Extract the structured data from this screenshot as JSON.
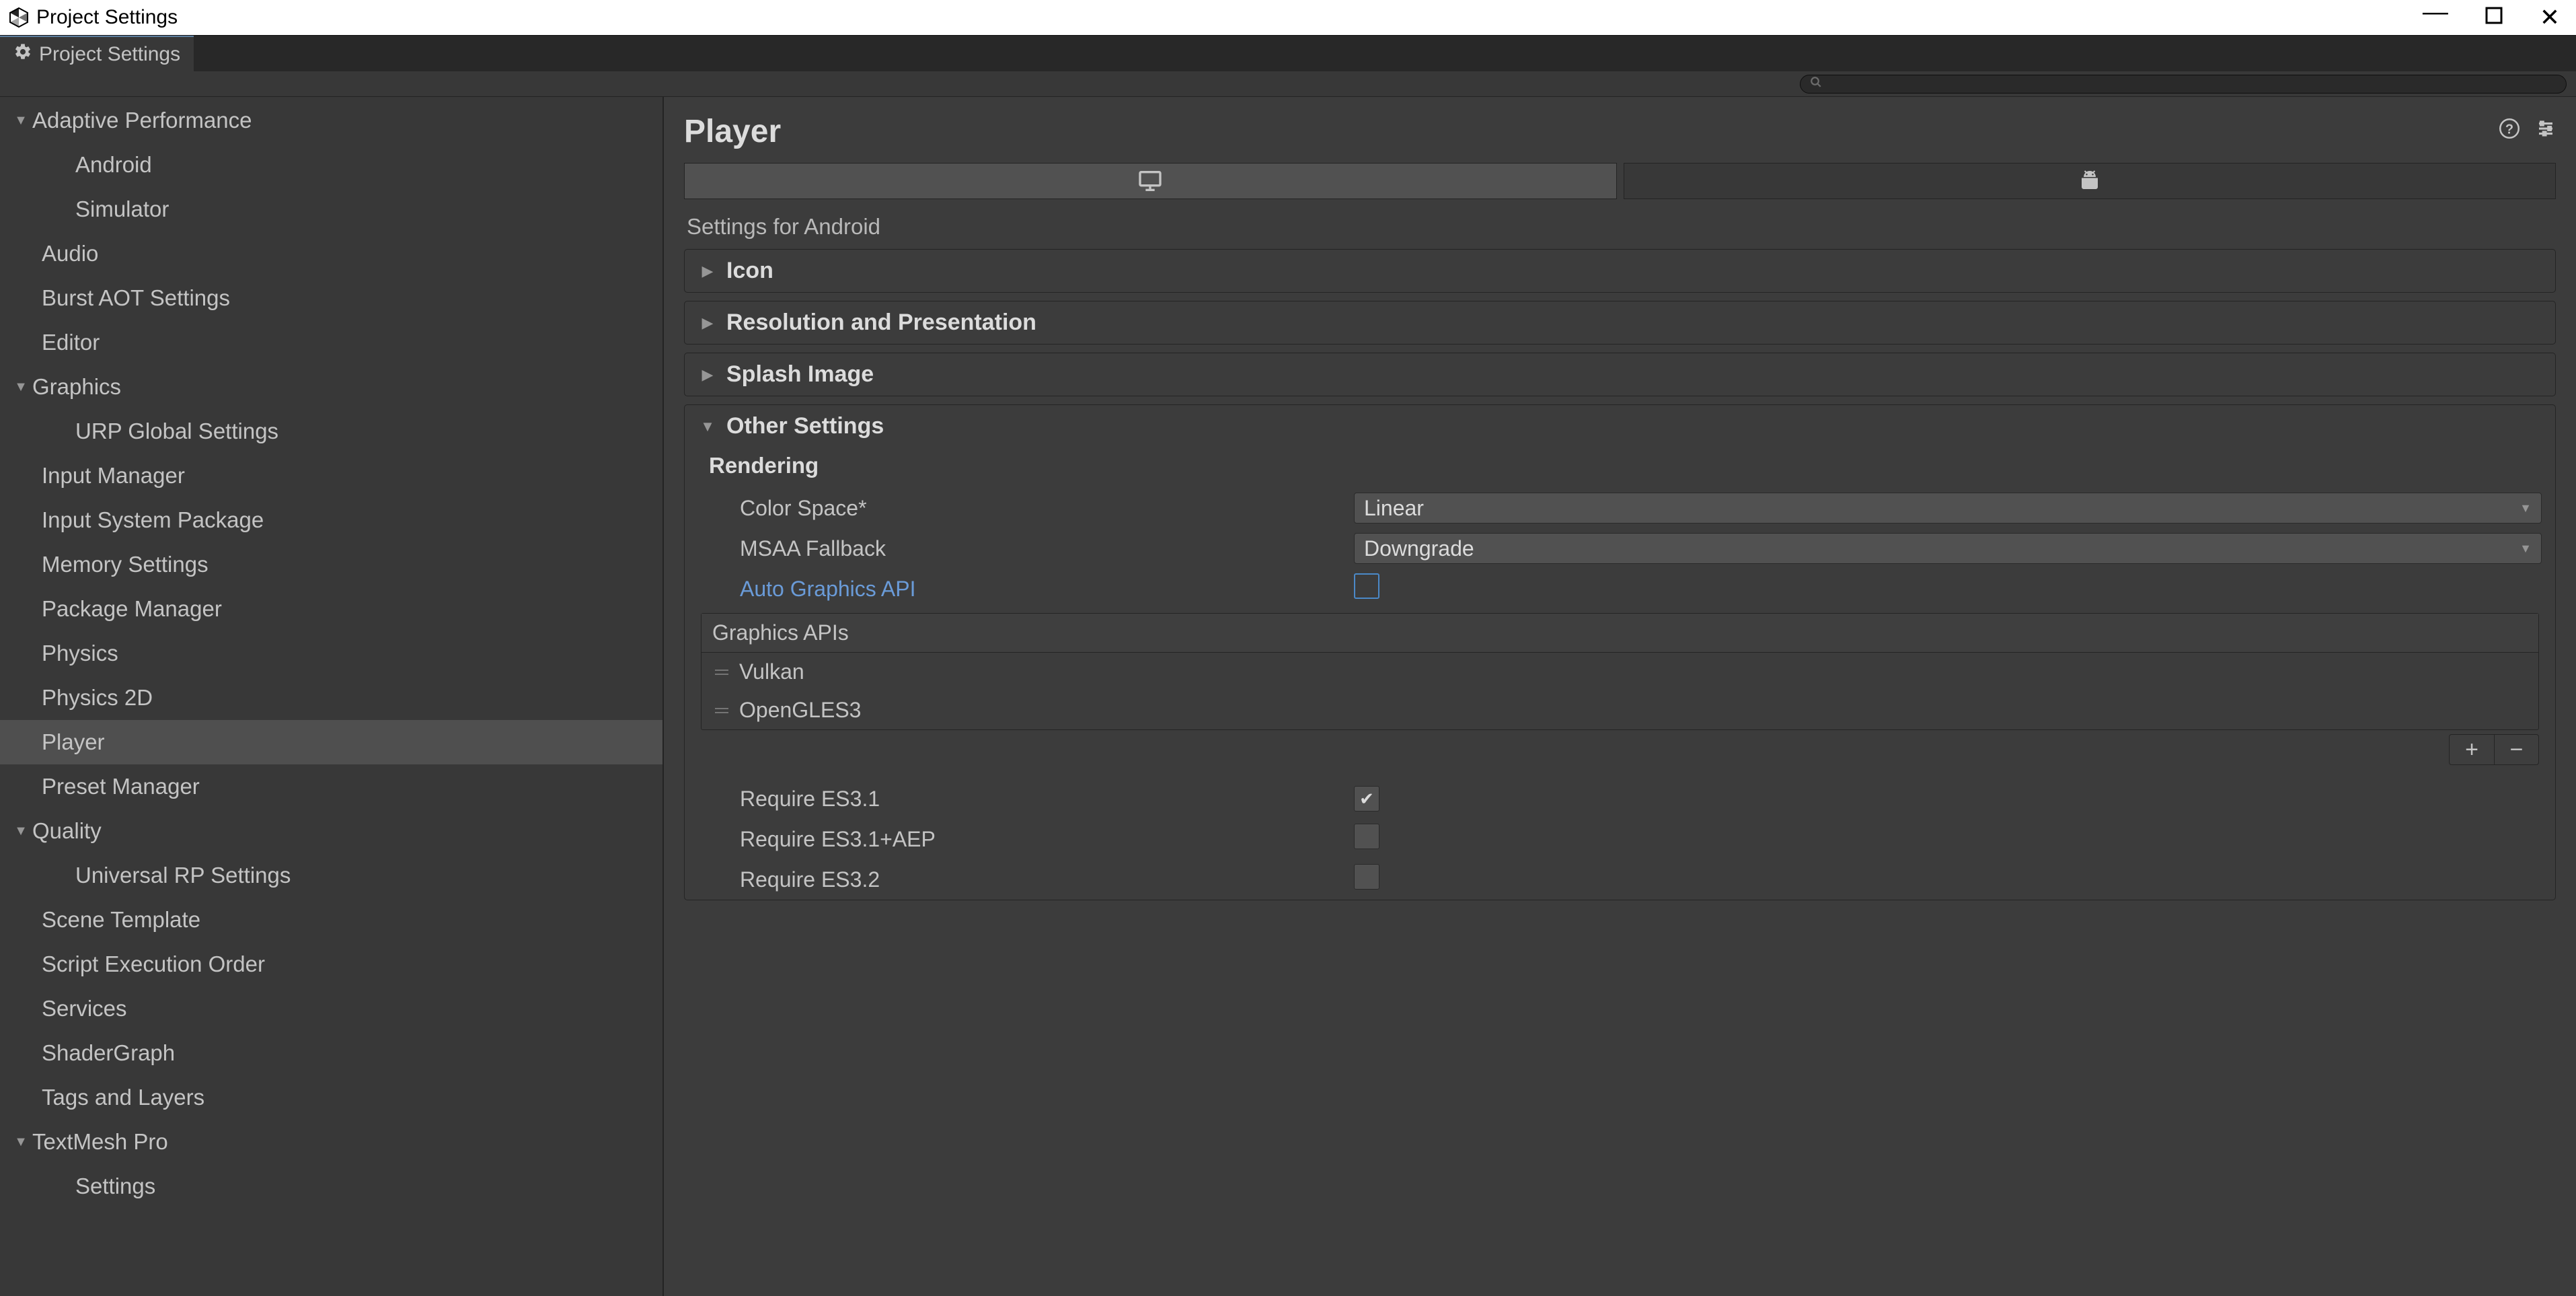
{
  "window": {
    "title": "Project Settings"
  },
  "tab": {
    "label": "Project Settings"
  },
  "search": {
    "placeholder": ""
  },
  "sidebar": {
    "items": [
      {
        "label": "Adaptive Performance",
        "expandable": true,
        "expanded": true,
        "level": 0
      },
      {
        "label": "Android",
        "level": 2
      },
      {
        "label": "Simulator",
        "level": 2
      },
      {
        "label": "Audio",
        "level": 1
      },
      {
        "label": "Burst AOT Settings",
        "level": 1
      },
      {
        "label": "Editor",
        "level": 1
      },
      {
        "label": "Graphics",
        "expandable": true,
        "expanded": true,
        "level": 0
      },
      {
        "label": "URP Global Settings",
        "level": 2
      },
      {
        "label": "Input Manager",
        "level": 1
      },
      {
        "label": "Input System Package",
        "level": 1
      },
      {
        "label": "Memory Settings",
        "level": 1
      },
      {
        "label": "Package Manager",
        "level": 1
      },
      {
        "label": "Physics",
        "level": 1
      },
      {
        "label": "Physics 2D",
        "level": 1
      },
      {
        "label": "Player",
        "level": 1,
        "selected": true
      },
      {
        "label": "Preset Manager",
        "level": 1
      },
      {
        "label": "Quality",
        "expandable": true,
        "expanded": true,
        "level": 0
      },
      {
        "label": "Universal RP Settings",
        "level": 2
      },
      {
        "label": "Scene Template",
        "level": 1
      },
      {
        "label": "Script Execution Order",
        "level": 1
      },
      {
        "label": "Services",
        "level": 1
      },
      {
        "label": "ShaderGraph",
        "level": 1
      },
      {
        "label": "Tags and Layers",
        "level": 1
      },
      {
        "label": "TextMesh Pro",
        "expandable": true,
        "expanded": true,
        "level": 0
      },
      {
        "label": "Settings",
        "level": 2
      }
    ]
  },
  "main": {
    "title": "Player",
    "platform_subtitle": "Settings for Android",
    "foldouts": {
      "icon": "Icon",
      "resolution": "Resolution and Presentation",
      "splash": "Splash Image",
      "other": "Other Settings"
    },
    "rendering": {
      "heading": "Rendering",
      "color_space_label": "Color Space*",
      "color_space_value": "Linear",
      "msaa_label": "MSAA Fallback",
      "msaa_value": "Downgrade",
      "auto_api_label": "Auto Graphics API",
      "graphics_apis_label": "Graphics APIs",
      "api_items": [
        "Vulkan",
        "OpenGLES3"
      ],
      "es31_label": "Require ES3.1",
      "es31aep_label": "Require ES3.1+AEP",
      "es32_label": "Require ES3.2"
    }
  }
}
